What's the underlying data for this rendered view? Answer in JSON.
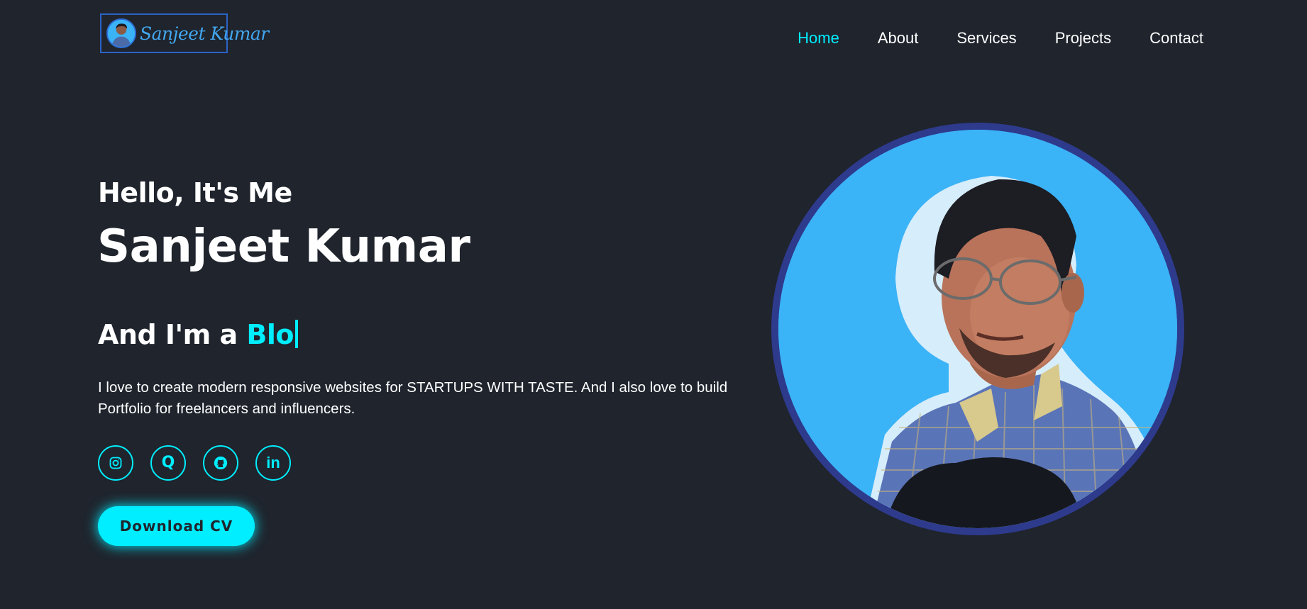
{
  "header": {
    "logo": {
      "text": "Sanjeet Kumar"
    },
    "nav": [
      {
        "label": "Home",
        "active": true
      },
      {
        "label": "About",
        "active": false
      },
      {
        "label": "Services",
        "active": false
      },
      {
        "label": "Projects",
        "active": false
      },
      {
        "label": "Contact",
        "active": false
      }
    ]
  },
  "hero": {
    "greeting": "Hello, It's Me",
    "name": "Sanjeet Kumar",
    "role_prefix": "And I'm a ",
    "role_typed": "Blo",
    "description": "I love to create modern responsive websites for STARTUPS WITH TASTE. And I also love to build Portfolio for freelancers and influencers.",
    "social": [
      {
        "icon": "instagram-icon"
      },
      {
        "icon": "quora-icon",
        "glyph": "Q"
      },
      {
        "icon": "github-icon"
      },
      {
        "icon": "linkedin-icon",
        "glyph": "in"
      }
    ],
    "cta_label": "Download CV"
  },
  "colors": {
    "background": "#1f242d",
    "accent": "#00eeff",
    "text": "#ffffff",
    "portrait_bg": "#3bb3f7",
    "portrait_ring": "#2e3a8c"
  }
}
